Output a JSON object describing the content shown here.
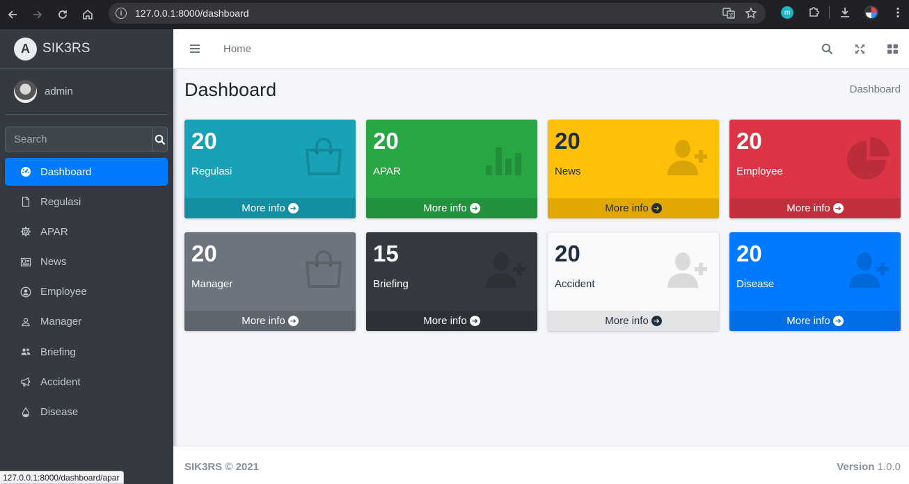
{
  "browser": {
    "url": "127.0.0.1:8000/dashboard",
    "status_url": "127.0.0.1:8000/dashboard/apar",
    "extension_letter": "m"
  },
  "sidebar": {
    "brand": "SIK3RS",
    "brand_logo_letter": "A",
    "user": "admin",
    "search_placeholder": "Search",
    "items": [
      {
        "label": "Dashboard",
        "icon": "tachometer-icon",
        "active": true
      },
      {
        "label": "Regulasi",
        "icon": "file-icon"
      },
      {
        "label": "APAR",
        "icon": "gear-icon"
      },
      {
        "label": "News",
        "icon": "newspaper-icon"
      },
      {
        "label": "Employee",
        "icon": "user-circle-icon"
      },
      {
        "label": "Manager",
        "icon": "user-icon"
      },
      {
        "label": "Briefing",
        "icon": "users-icon"
      },
      {
        "label": "Accident",
        "icon": "megaphone-icon"
      },
      {
        "label": "Disease",
        "icon": "tint-icon"
      }
    ]
  },
  "topbar": {
    "home_label": "Home"
  },
  "header": {
    "title": "Dashboard",
    "breadcrumb": "Dashboard"
  },
  "boxes": [
    {
      "count": "20",
      "label": "Regulasi",
      "footer": "More info",
      "color": "#17a2b8",
      "footer_color": "#148fa2",
      "text_color": "#ffffff",
      "icon": "shopping-bag-icon"
    },
    {
      "count": "20",
      "label": "APAR",
      "footer": "More info",
      "color": "#28a745",
      "footer_color": "#23923d",
      "text_color": "#ffffff",
      "icon": "bar-chart-icon"
    },
    {
      "count": "20",
      "label": "News",
      "footer": "More info",
      "color": "#ffc107",
      "footer_color": "#e0a800",
      "text_color": "#1f2d3d",
      "icon": "user-plus-icon"
    },
    {
      "count": "20",
      "label": "Employee",
      "footer": "More info",
      "color": "#dc3545",
      "footer_color": "#c2303d",
      "text_color": "#ffffff",
      "icon": "pie-chart-icon"
    },
    {
      "count": "20",
      "label": "Manager",
      "footer": "More info",
      "color": "#6c757d",
      "footer_color": "#5f666d",
      "text_color": "#ffffff",
      "icon": "shopping-bag-icon"
    },
    {
      "count": "15",
      "label": "Briefing",
      "footer": "More info",
      "color": "#343a40",
      "footer_color": "#2d3238",
      "text_color": "#ffffff",
      "icon": "user-plus-icon"
    },
    {
      "count": "20",
      "label": "Accident",
      "footer": "More info",
      "color": "#f8f9fa",
      "footer_color": "#e2e3e5",
      "text_color": "#1f2d3d",
      "icon": "user-plus-icon"
    },
    {
      "count": "20",
      "label": "Disease",
      "footer": "More info",
      "color": "#007bff",
      "footer_color": "#006fe6",
      "text_color": "#ffffff",
      "icon": "user-plus-icon"
    }
  ],
  "footer": {
    "copyright": "SIK3RS © 2021",
    "version_label": "Version",
    "version_value": "1.0.0"
  }
}
